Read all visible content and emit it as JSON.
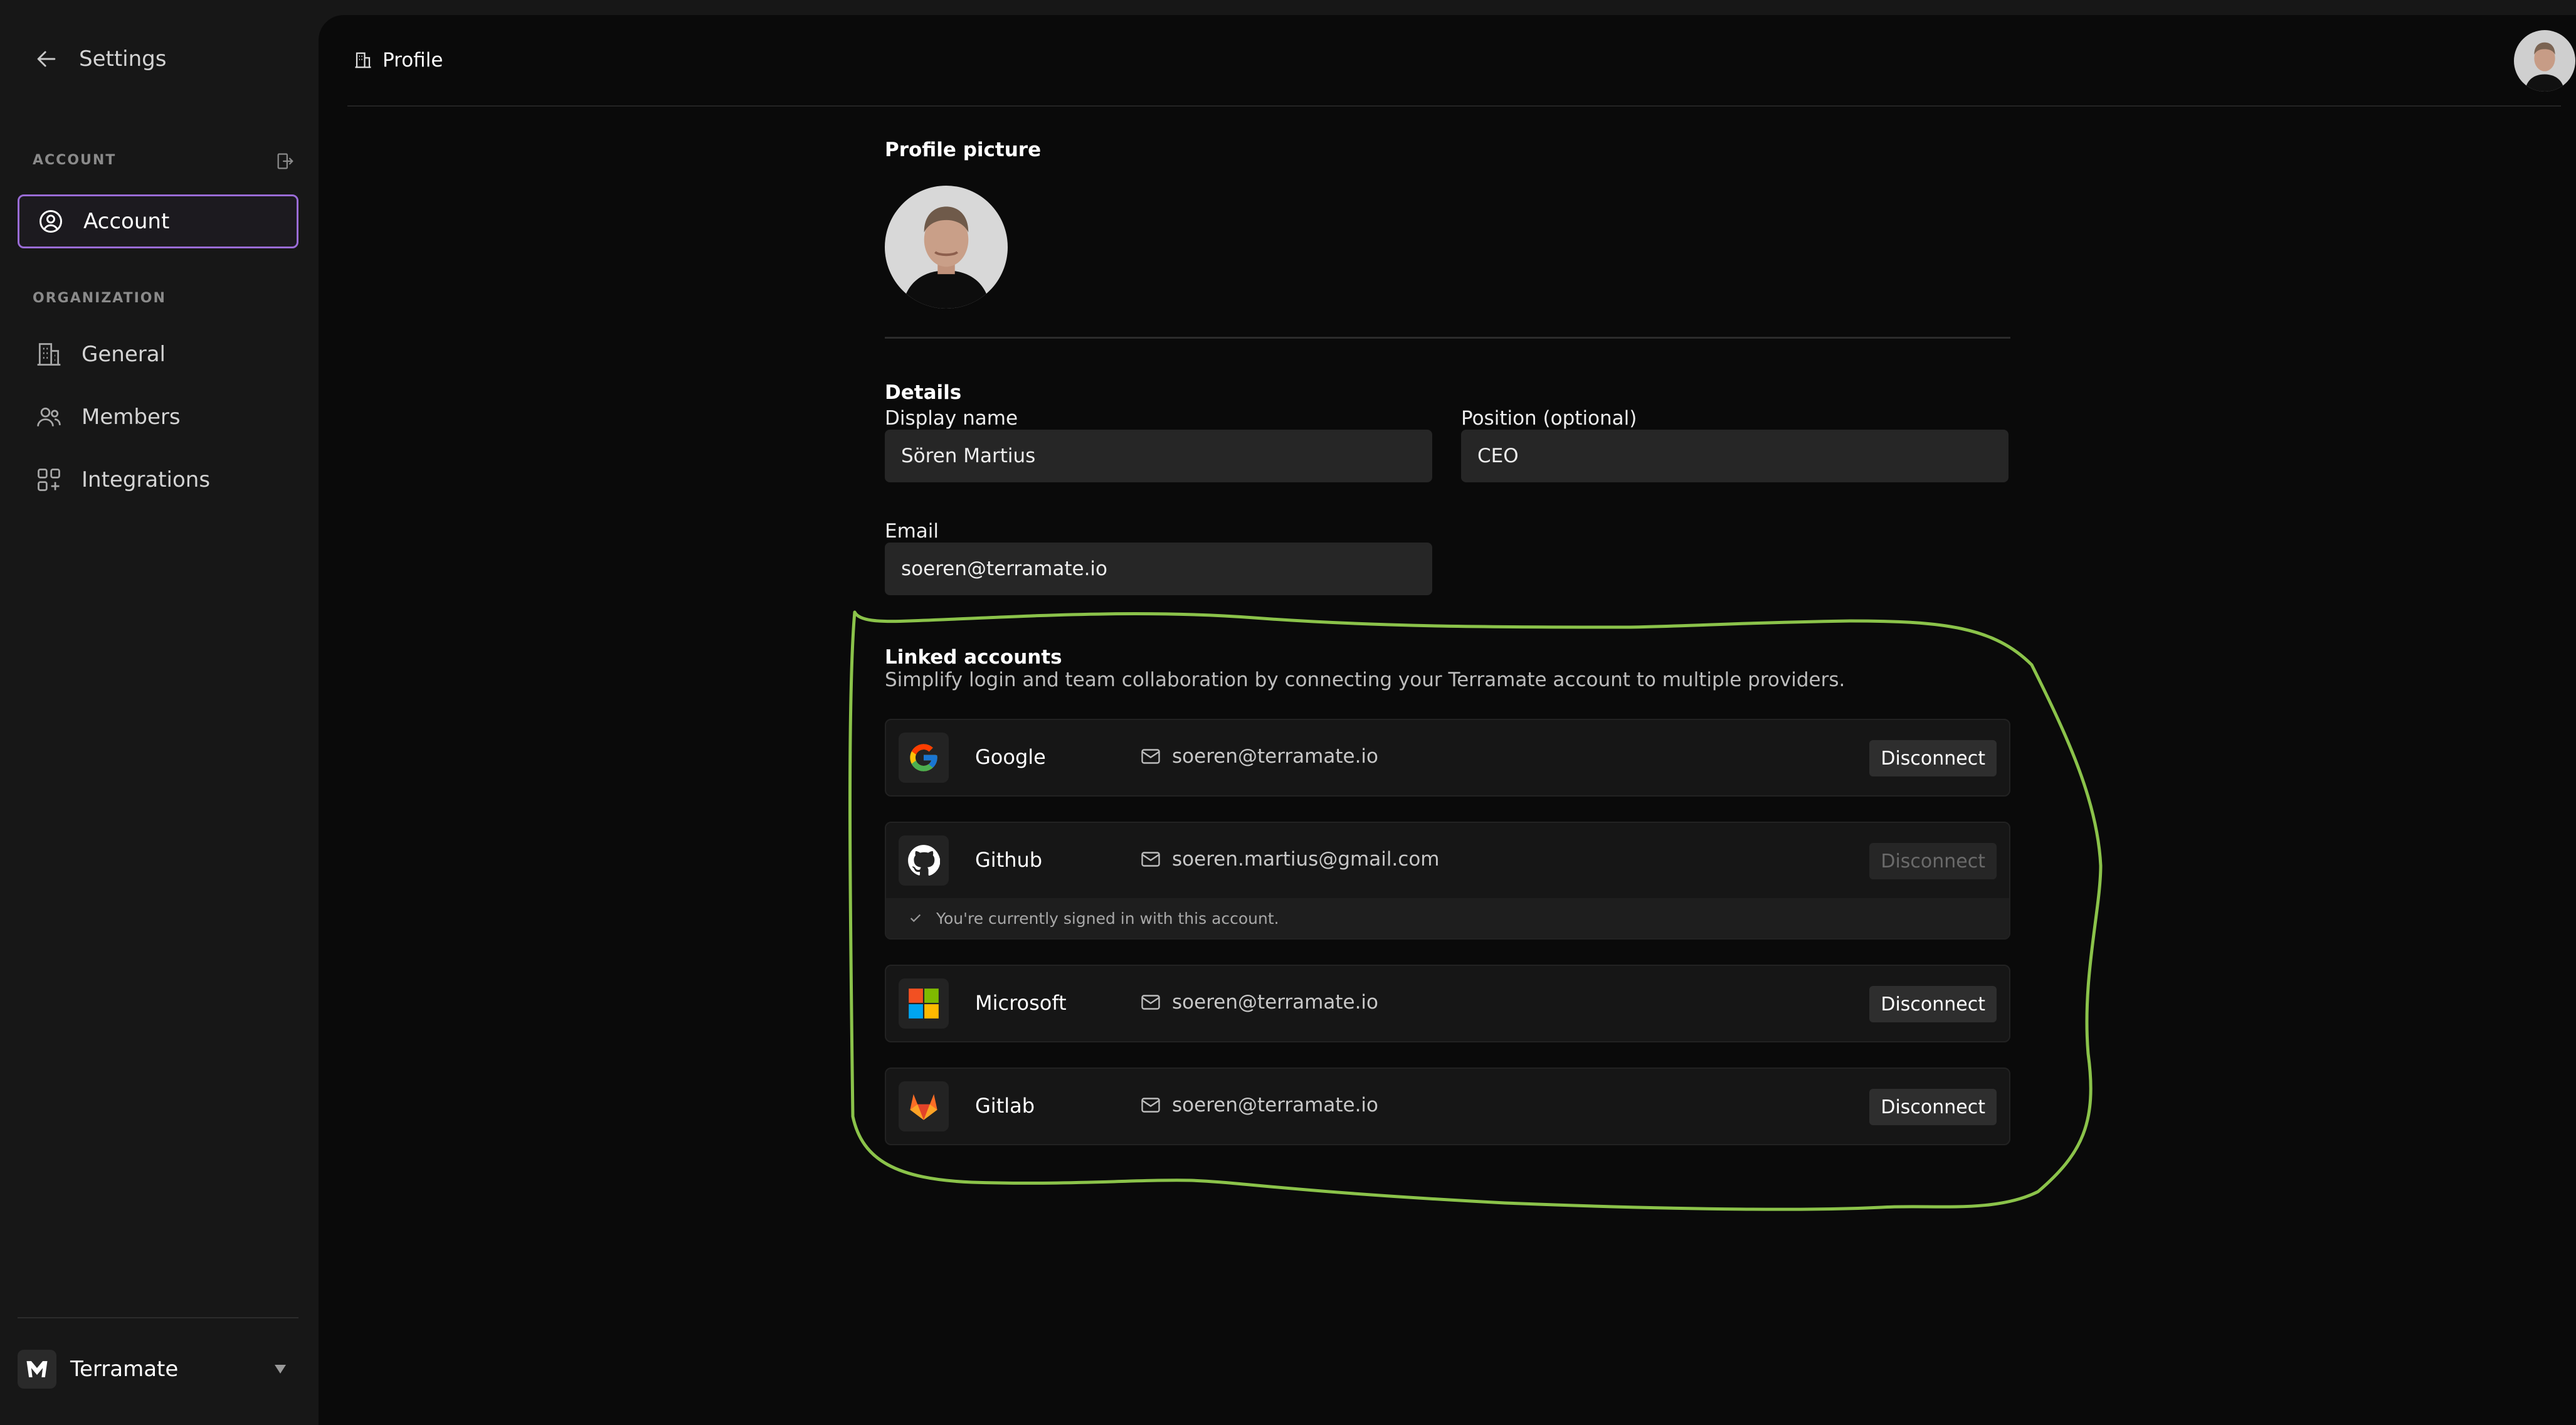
{
  "sidebar": {
    "back_label": "Settings",
    "account_section": "ACCOUNT",
    "org_section": "ORGANIZATION",
    "items": [
      {
        "label": "Account",
        "icon": "user-circle-icon",
        "active": true
      },
      {
        "label": "General",
        "icon": "building-icon"
      },
      {
        "label": "Members",
        "icon": "users-icon"
      },
      {
        "label": "Integrations",
        "icon": "grid-plus-icon"
      }
    ],
    "org_name": "Terramate"
  },
  "header": {
    "breadcrumb": "Profile"
  },
  "profile": {
    "picture_title": "Profile picture",
    "details_title": "Details",
    "display_name_label": "Display name",
    "display_name_value": "Sören Martius",
    "position_label": "Position (optional)",
    "position_value": "CEO",
    "email_label": "Email",
    "email_value": "soeren@terramate.io"
  },
  "linked_accounts": {
    "title": "Linked accounts",
    "description": "Simplify login and team collaboration by connecting your Terramate account to multiple providers.",
    "accounts": [
      {
        "provider": "Google",
        "email": "soeren@terramate.io",
        "action": "Disconnect",
        "icon": "google-icon"
      },
      {
        "provider": "Github",
        "email": "soeren.martius@gmail.com",
        "action": "Disconnect",
        "disabled": true,
        "note": "You're currently signed in with this account.",
        "icon": "github-icon"
      },
      {
        "provider": "Microsoft",
        "email": "soeren@terramate.io",
        "action": "Disconnect",
        "icon": "microsoft-icon"
      },
      {
        "provider": "Gitlab",
        "email": "soeren@terramate.io",
        "action": "Disconnect",
        "icon": "gitlab-icon"
      }
    ]
  },
  "colors": {
    "accent": "#9a6cd6",
    "annotation": "#8bc34a",
    "background": "#0a0a0a"
  }
}
